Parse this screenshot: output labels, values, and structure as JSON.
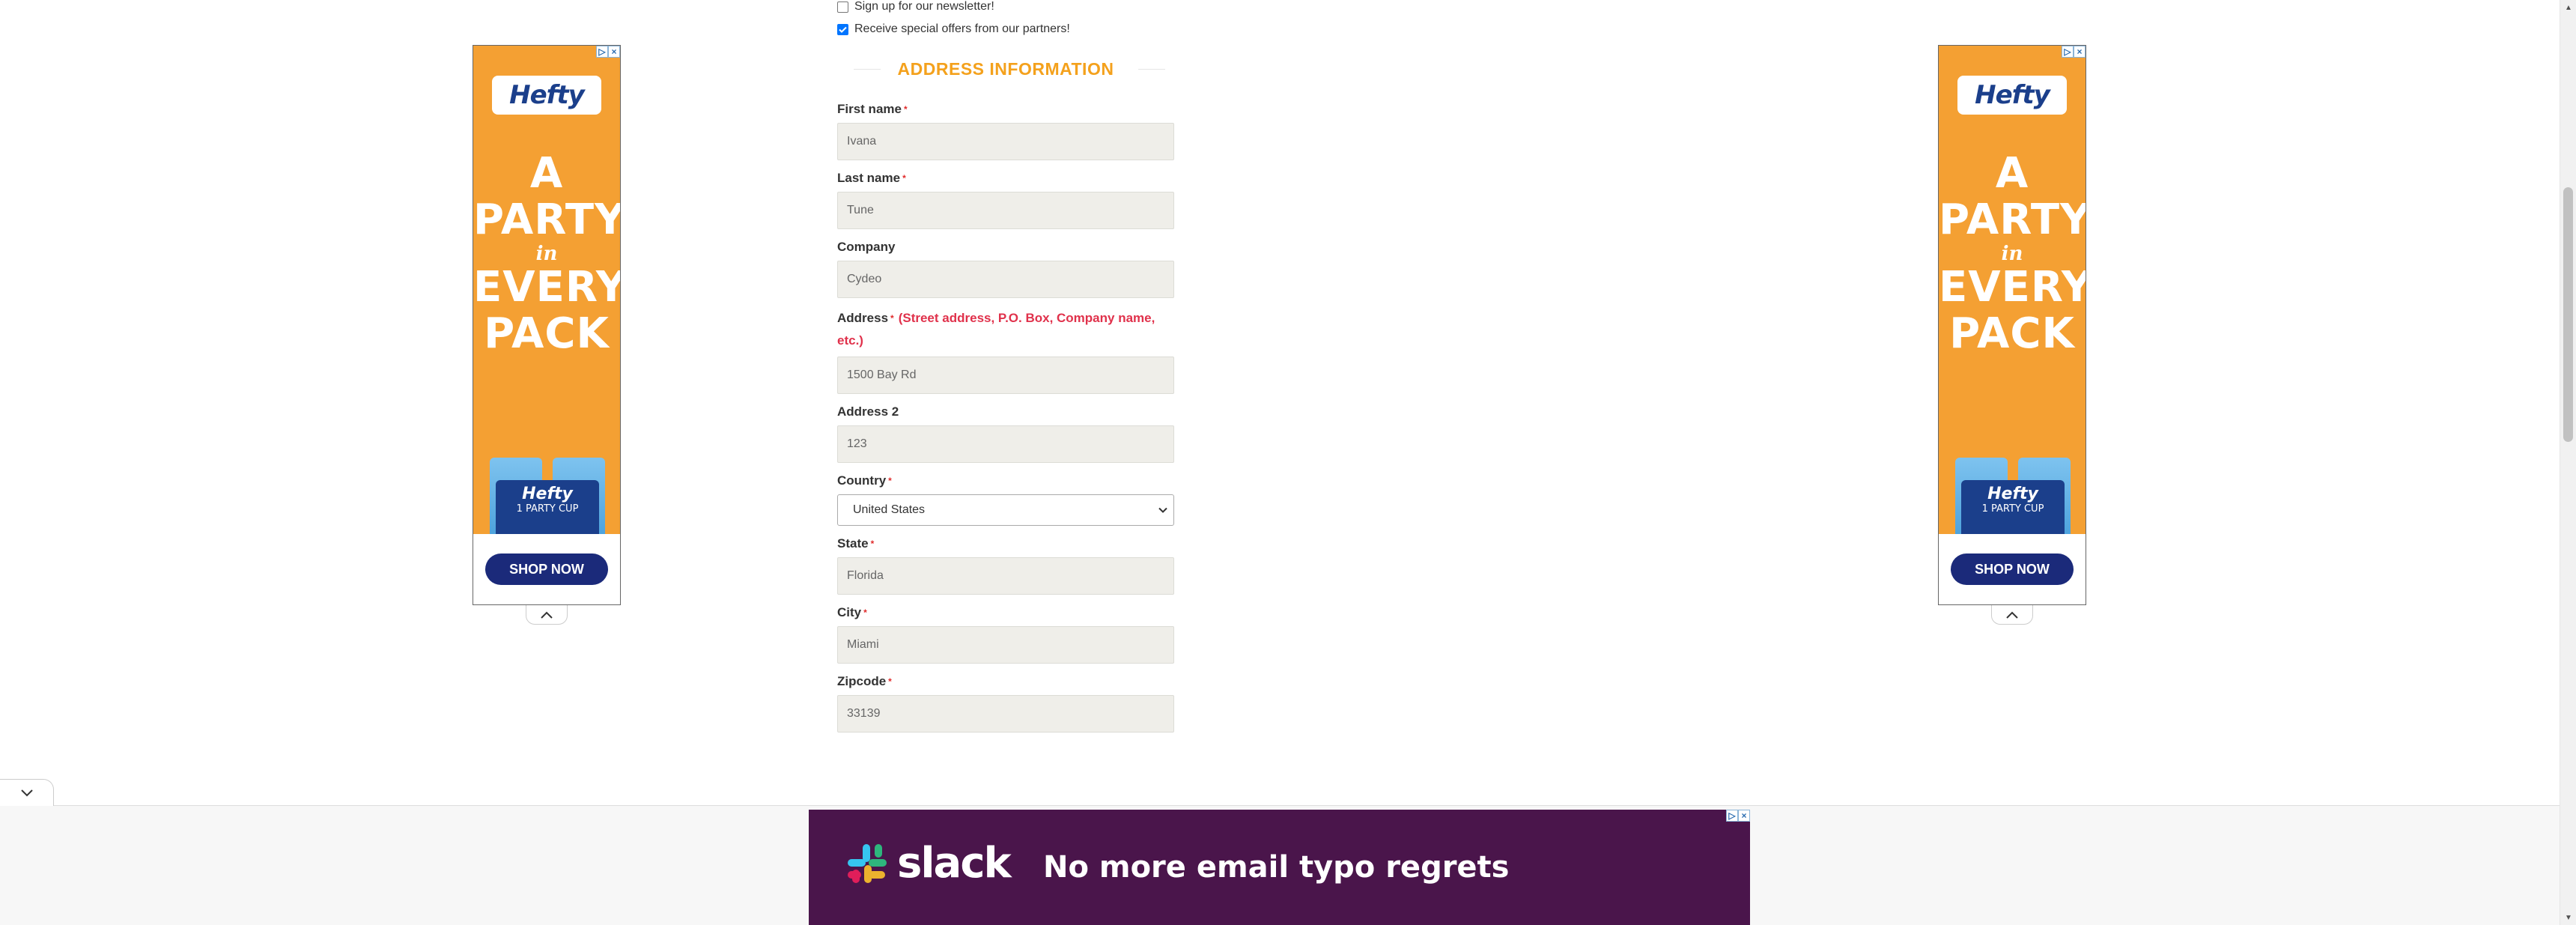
{
  "checkboxes": {
    "newsletter": {
      "label": "Sign up for our newsletter!",
      "checked": false
    },
    "offers": {
      "label": "Receive special offers from our partners!",
      "checked": true
    }
  },
  "section": {
    "title": "ADDRESS INFORMATION"
  },
  "form": {
    "required_mark": "*",
    "first_name": {
      "label": "First name",
      "value": "Ivana"
    },
    "last_name": {
      "label": "Last name",
      "value": "Tune"
    },
    "company": {
      "label": "Company",
      "value": "Cydeo"
    },
    "address": {
      "label": "Address",
      "hint": "(Street address, P.O. Box, Company name, etc.)",
      "value": "1500 Bay Rd"
    },
    "address2": {
      "label": "Address 2",
      "value": "123"
    },
    "country": {
      "label": "Country",
      "value": "United States"
    },
    "state": {
      "label": "State",
      "value": "Florida"
    },
    "city": {
      "label": "City",
      "value": "Miami"
    },
    "zipcode": {
      "label": "Zipcode",
      "value": "33139"
    }
  },
  "side_ad": {
    "brand": "Hefty",
    "line1": "A",
    "line2": "PARTY",
    "line3": "in",
    "line4": "EVERY",
    "line5": "PACK",
    "product_brand": "Hefty",
    "product_name": "1 PARTY CUP",
    "cta": "SHOP NOW",
    "brand_color": "#1b3f8b",
    "background_color": "#f4a033"
  },
  "bottom_ad": {
    "brand": "slack",
    "tagline": "No more email typo regrets",
    "background_color": "#4a154b"
  },
  "icons": {
    "ad_choices": "ad-choices-icon",
    "ad_close": "close-icon",
    "collapse": "chevron-up-icon",
    "expand": "chevron-down-icon",
    "select": "chevron-down-icon"
  }
}
